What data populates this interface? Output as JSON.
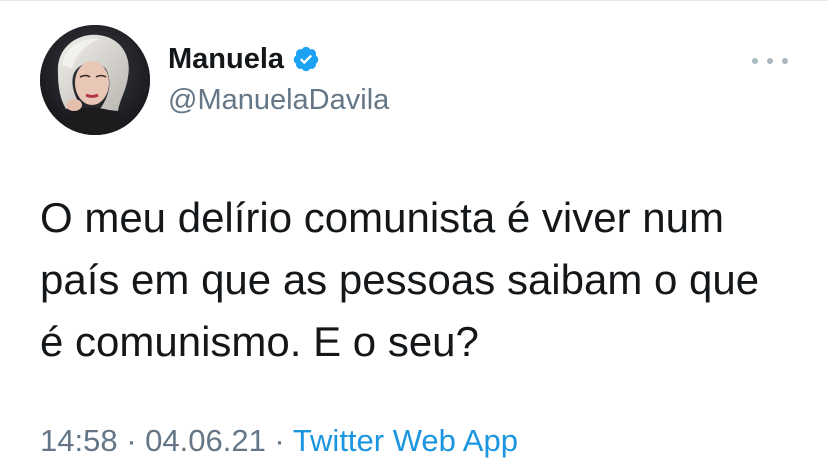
{
  "tweet": {
    "author": {
      "display_name": "Manuela",
      "handle": "@ManuelaDavila",
      "verified_icon": "verified-badge-icon",
      "verified_color": "#1da1f2"
    },
    "more_icon": "more-options-icon",
    "text_lines": [
      "O meu delírio comunista é viver num",
      "país em que as pessoas saibam o que",
      "é comunismo. E o seu?"
    ],
    "time": "14:58",
    "separator": " · ",
    "date": "04.06.21",
    "source": "Twitter Web App",
    "link_color": "#1b95e0"
  }
}
